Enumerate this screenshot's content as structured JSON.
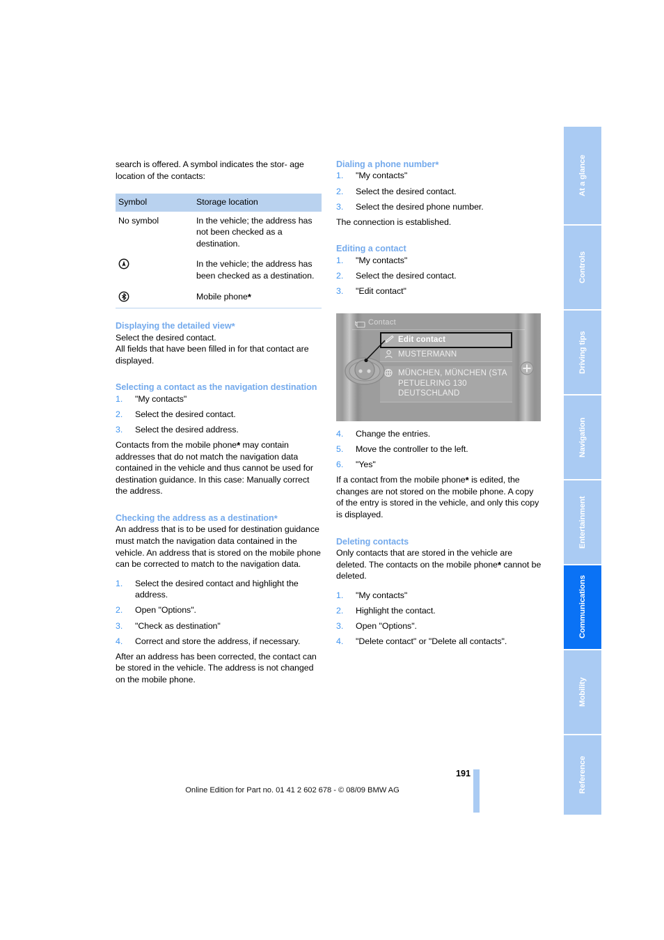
{
  "page": {
    "number": "191",
    "footer_note": "Online Edition for Part no. 01 41 2 602 678 - © 08/09 BMW AG"
  },
  "colors": {
    "heading": "#74aaec",
    "list_number": "#3f94f0",
    "table_header_bg": "#b9d2ef",
    "tab_bg": "#aacbf3",
    "tab_active_bg": "#0a72f5"
  },
  "left_column": {
    "intro_lines": [
      "search is offered. A symbol indicates the stor-",
      "age location of the contacts:"
    ],
    "table": {
      "headers": [
        "Symbol",
        "Storage location"
      ],
      "rows": [
        {
          "symbol_text": "No symbol",
          "symbol_icon": "",
          "location": "In the vehicle; the address has not been checked as a destination."
        },
        {
          "symbol_text": "",
          "symbol_icon": "destination-checked-icon",
          "location": "In the vehicle; the address has been checked as a destination."
        },
        {
          "symbol_text": "",
          "symbol_icon": "bluetooth-icon",
          "location": "Mobile phone*"
        }
      ]
    },
    "sections": [
      {
        "heading": "Displaying the detailed view*",
        "paragraphs": [
          "Select the desired contact.",
          "All fields that have been filled in for that contact are displayed."
        ],
        "steps": []
      },
      {
        "heading": "Selecting a contact as the navigation destination",
        "paragraphs": [],
        "steps": [
          "\"My contacts\"",
          "Select the desired contact.",
          "Select the desired address."
        ],
        "after_paragraphs": [
          "Contacts from the mobile phone* may contain addresses that do not match the navigation data contained in the vehicle and thus cannot be used for destination guidance. In this case: Manually correct the address."
        ]
      },
      {
        "heading": "Checking the address as a destination*",
        "paragraphs": [
          "An address that is to be used for destination guidance must match the navigation data contained in the vehicle. An address that is stored on the mobile phone can be corrected to match to the navigation data."
        ],
        "steps": [
          "Select the desired contact and highlight the address.",
          "Open \"Options\".",
          "\"Check as destination\"",
          "Correct and store the address, if necessary."
        ],
        "after_paragraphs": [
          "After an address has been corrected, the contact can be stored in the vehicle. The address is not changed on the mobile phone."
        ]
      }
    ]
  },
  "right_column": {
    "sections_top": [
      {
        "heading": "Dialing a phone number*",
        "steps": [
          "\"My contacts\"",
          "Select the desired contact.",
          "Select the desired phone number."
        ],
        "after_paragraphs": [
          "The connection is established."
        ]
      },
      {
        "heading": "Editing a contact",
        "steps": [
          "\"My contacts\"",
          "Select the desired contact.",
          "\"Edit contact\""
        ],
        "after_paragraphs": []
      }
    ],
    "figure": {
      "title": "Contact",
      "title_icon": "contact-card-icon",
      "rows": [
        {
          "icon": "pencil-icon",
          "label": "Edit contact",
          "selected": true
        },
        {
          "icon": "person-icon",
          "label": "MUSTERMANN",
          "selected": false
        }
      ],
      "address_icon": "globe-address-icon",
      "address_lines": [
        "MÜNCHEN, MÜNCHEN (STA",
        "PETUELRING 130",
        "DEUTSCHLAND"
      ]
    },
    "sections_bottom": [
      {
        "heading": "",
        "steps_start": 4,
        "steps": [
          "Change the entries.",
          "Move the controller to the left.",
          "\"Yes\""
        ],
        "after_paragraphs": [
          "If a contact from the mobile phone* is edited, the changes are not stored on the mobile phone. A copy of the entry is stored in the vehicle, and only this copy is displayed."
        ]
      },
      {
        "heading": "Deleting contacts",
        "paragraphs": [
          "Only contacts that are stored in the vehicle are deleted. The contacts on the mobile phone* cannot be deleted."
        ],
        "steps_start": 1,
        "steps": [
          "\"My contacts\"",
          "Highlight the contact.",
          "Open \"Options\".",
          "\"Delete contact\" or \"Delete all contacts\"."
        ],
        "after_paragraphs": []
      }
    ]
  },
  "tabs": [
    {
      "label": "At a glance",
      "active": false
    },
    {
      "label": "Controls",
      "active": false
    },
    {
      "label": "Driving tips",
      "active": false
    },
    {
      "label": "Navigation",
      "active": false
    },
    {
      "label": "Entertainment",
      "active": false
    },
    {
      "label": "Communications",
      "active": true
    },
    {
      "label": "Mobility",
      "active": false
    },
    {
      "label": "Reference",
      "active": false
    }
  ]
}
